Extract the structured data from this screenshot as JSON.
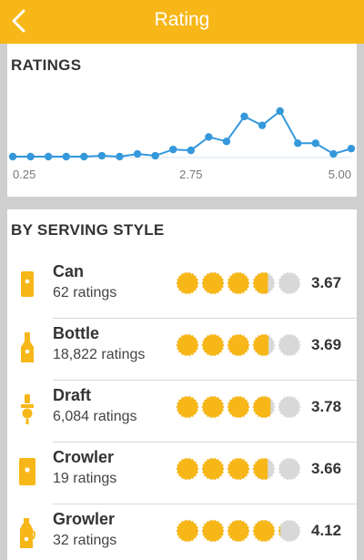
{
  "header": {
    "title": "Rating"
  },
  "ratings_section": {
    "title": "RATINGS"
  },
  "chart_data": {
    "type": "line",
    "title": "",
    "xlabel": "",
    "ylabel": "",
    "x": [
      0.25,
      0.5,
      0.75,
      1.0,
      1.25,
      1.5,
      1.75,
      2.0,
      2.25,
      2.5,
      2.75,
      3.0,
      3.25,
      3.5,
      3.75,
      4.0,
      4.25,
      4.5,
      4.75,
      5.0
    ],
    "y": [
      0.0,
      0.0,
      0.0,
      0.0,
      0.0,
      0.01,
      0.0,
      0.03,
      0.01,
      0.08,
      0.07,
      0.22,
      0.17,
      0.45,
      0.35,
      0.51,
      0.15,
      0.15,
      0.03,
      0.09
    ],
    "xlim": [
      0.25,
      5.0
    ],
    "x_tick_labels": [
      "0.25",
      "2.75",
      "5.00"
    ],
    "color": "#3498DB",
    "grid": false
  },
  "serving_section": {
    "title": "BY SERVING STYLE"
  },
  "styles": [
    {
      "name": "Can",
      "count": "62 ratings",
      "score": "3.67",
      "value": 3.67,
      "icon": "can-icon"
    },
    {
      "name": "Bottle",
      "count": "18,822 ratings",
      "score": "3.69",
      "value": 3.69,
      "icon": "bottle-icon"
    },
    {
      "name": "Draft",
      "count": "6,084 ratings",
      "score": "3.78",
      "value": 3.78,
      "icon": "draft-tap-icon"
    },
    {
      "name": "Crowler",
      "count": "19 ratings",
      "score": "3.66",
      "value": 3.66,
      "icon": "crowler-icon"
    },
    {
      "name": "Growler",
      "count": "32 ratings",
      "score": "4.12",
      "value": 4.12,
      "icon": "growler-icon"
    }
  ],
  "colors": {
    "accent": "#F7B718",
    "cap_empty": "#D8D8D8",
    "line": "#3498DB"
  }
}
